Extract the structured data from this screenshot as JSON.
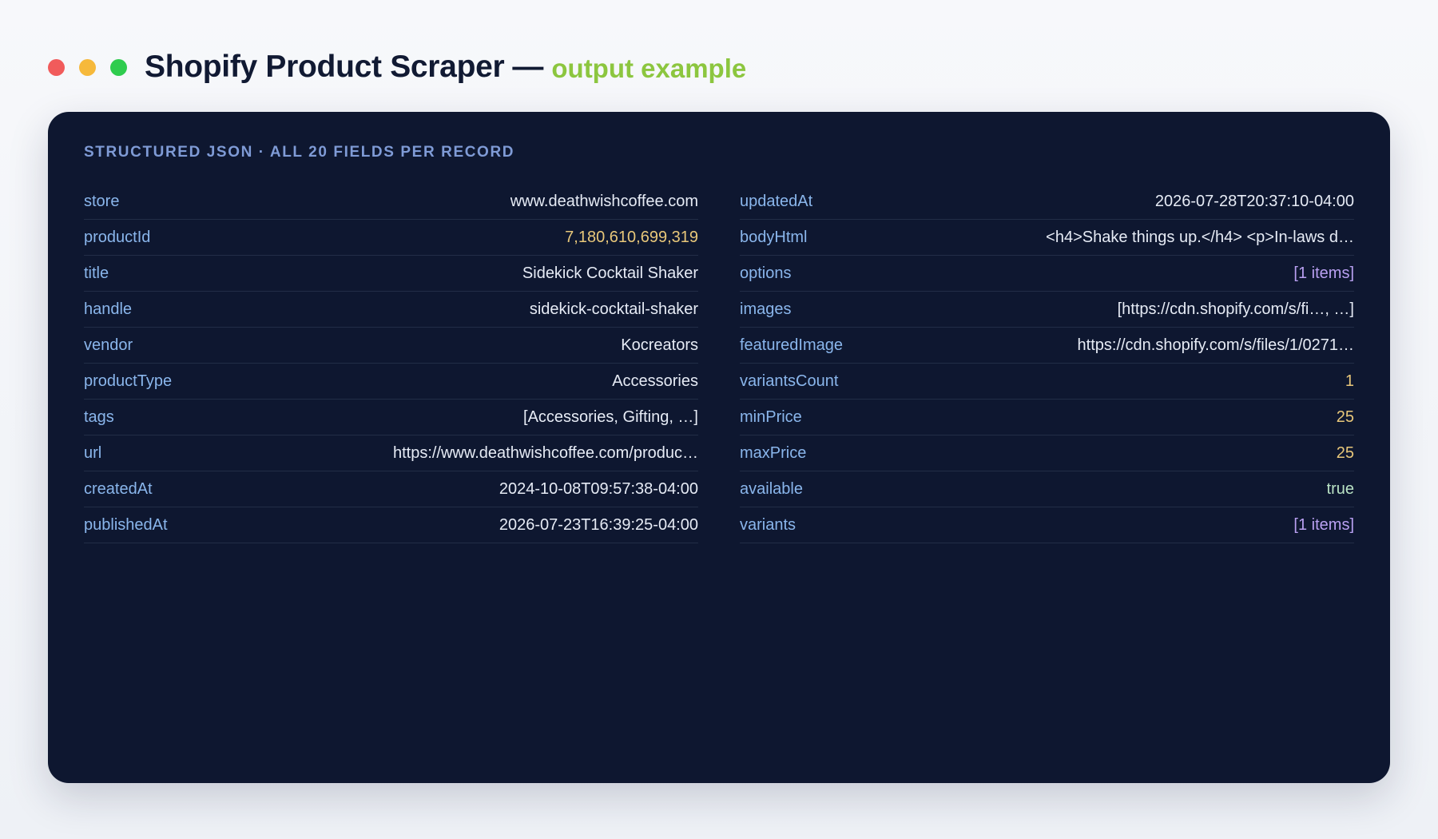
{
  "header": {
    "title": "Shopify Product Scraper",
    "separator": "—",
    "subtitle": "output example",
    "window_dots": [
      {
        "name": "close",
        "color": "#f15b5b"
      },
      {
        "name": "minimize",
        "color": "#f6b93b"
      },
      {
        "name": "maximize",
        "color": "#2fcc4e"
      }
    ]
  },
  "card": {
    "heading": "STRUCTURED JSON · ALL 20 FIELDS PER RECORD",
    "left_fields": [
      {
        "key": "store",
        "value": "www.deathwishcoffee.com",
        "kind": "str"
      },
      {
        "key": "productId",
        "value": "7,180,610,699,319",
        "kind": "num"
      },
      {
        "key": "title",
        "value": "Sidekick Cocktail Shaker",
        "kind": "str"
      },
      {
        "key": "handle",
        "value": "sidekick-cocktail-shaker",
        "kind": "str"
      },
      {
        "key": "vendor",
        "value": "Kocreators",
        "kind": "str"
      },
      {
        "key": "productType",
        "value": "Accessories",
        "kind": "str"
      },
      {
        "key": "tags",
        "value": "[Accessories, Gifting, …]",
        "kind": "str"
      },
      {
        "key": "url",
        "value": "https://www.deathwishcoffee.com/produc…",
        "kind": "str"
      },
      {
        "key": "createdAt",
        "value": "2024-10-08T09:57:38-04:00",
        "kind": "str"
      },
      {
        "key": "publishedAt",
        "value": "2026-07-23T16:39:25-04:00",
        "kind": "str"
      }
    ],
    "right_fields": [
      {
        "key": "updatedAt",
        "value": "2026-07-28T20:37:10-04:00",
        "kind": "str"
      },
      {
        "key": "bodyHtml",
        "value": "<h4>Shake things up.</h4> <p>In-laws d…",
        "kind": "str"
      },
      {
        "key": "options",
        "value": "[1 items]",
        "kind": "arr"
      },
      {
        "key": "images",
        "value": "[https://cdn.shopify.com/s/fi…, …]",
        "kind": "str"
      },
      {
        "key": "featuredImage",
        "value": "https://cdn.shopify.com/s/files/1/0271…",
        "kind": "str"
      },
      {
        "key": "variantsCount",
        "value": "1",
        "kind": "num"
      },
      {
        "key": "minPrice",
        "value": "25",
        "kind": "num"
      },
      {
        "key": "maxPrice",
        "value": "25",
        "kind": "num"
      },
      {
        "key": "available",
        "value": "true",
        "kind": "bool"
      },
      {
        "key": "variants",
        "value": "[1 items]",
        "kind": "arr"
      }
    ]
  }
}
